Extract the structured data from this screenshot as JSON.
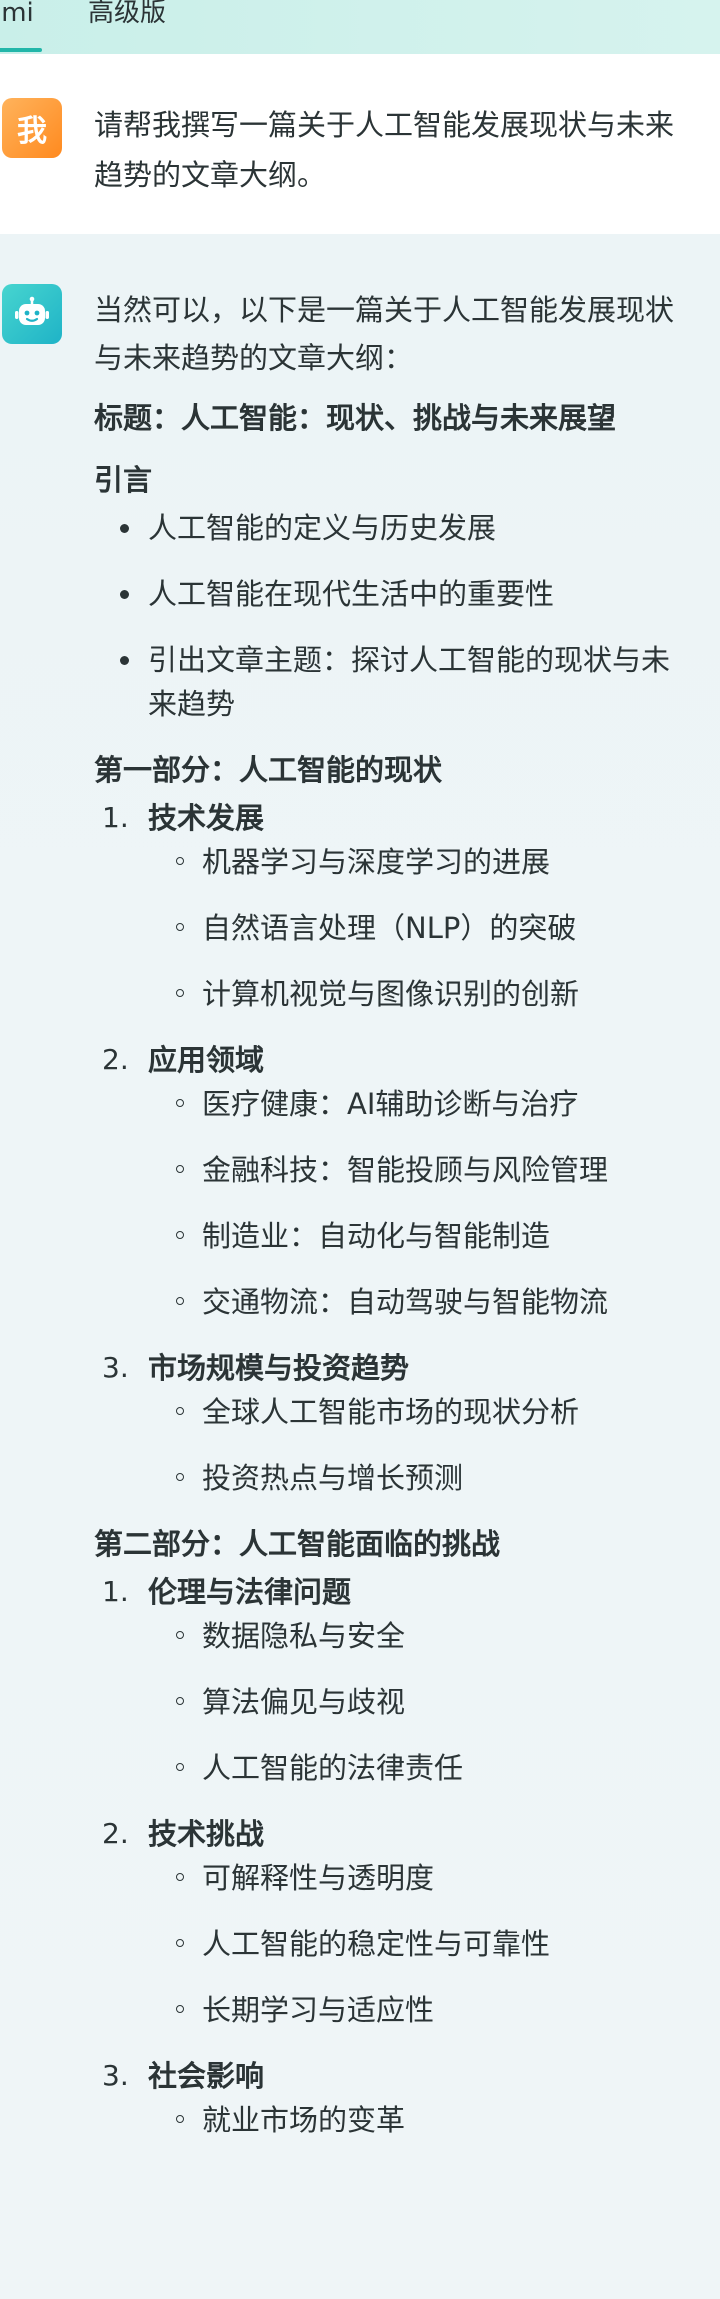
{
  "tabs": [
    {
      "label": "imi"
    },
    {
      "label": "高级版"
    }
  ],
  "user": {
    "avatar_label": "我",
    "message": "请帮我撰写一篇关于人工智能发展现状与未来趋势的文章大纲。"
  },
  "bot": {
    "avatar_icon": "robot-icon",
    "intro": "当然可以，以下是一篇关于人工智能发展现状与未来趋势的文章大纲：",
    "title": "标题：人工智能：现状、挑战与未来展望",
    "intro_heading": "引言",
    "intro_items": [
      "人工智能的定义与历史发展",
      "人工智能在现代生活中的重要性",
      "引出文章主题：探讨人工智能的现状与未来趋势"
    ],
    "sections": [
      {
        "heading": "第一部分：人工智能的现状",
        "items": [
          {
            "num": "1.",
            "title": "技术发展",
            "subs": [
              "机器学习与深度学习的进展",
              "自然语言处理（NLP）的突破",
              "计算机视觉与图像识别的创新"
            ]
          },
          {
            "num": "2.",
            "title": "应用领域",
            "subs": [
              "医疗健康：AI辅助诊断与治疗",
              "金融科技：智能投顾与风险管理",
              "制造业：自动化与智能制造",
              "交通物流：自动驾驶与智能物流"
            ]
          },
          {
            "num": "3.",
            "title": "市场规模与投资趋势",
            "subs": [
              "全球人工智能市场的现状分析",
              "投资热点与增长预测"
            ]
          }
        ]
      },
      {
        "heading": "第二部分：人工智能面临的挑战",
        "items": [
          {
            "num": "1.",
            "title": "伦理与法律问题",
            "subs": [
              "数据隐私与安全",
              "算法偏见与歧视",
              "人工智能的法律责任"
            ]
          },
          {
            "num": "2.",
            "title": "技术挑战",
            "subs": [
              "可解释性与透明度",
              "人工智能的稳定性与可靠性",
              "长期学习与适应性"
            ]
          },
          {
            "num": "3.",
            "title": "社会影响",
            "subs": [
              "就业市场的变革"
            ]
          }
        ]
      }
    ]
  },
  "colors": {
    "accent": "#22b6a9",
    "user_avatar": "#ff8a1f",
    "bot_avatar": "#1fb3c7"
  }
}
